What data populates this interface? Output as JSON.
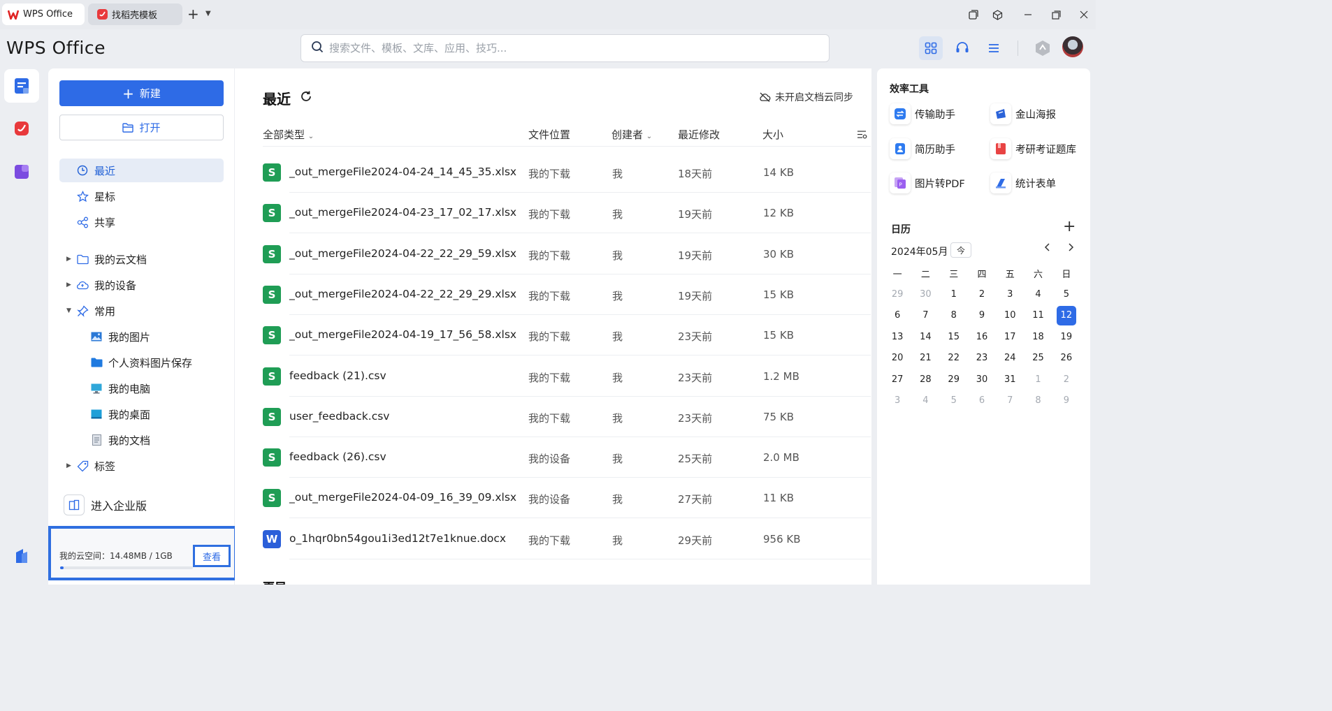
{
  "tabs": [
    {
      "label": "WPS Office"
    },
    {
      "label": "找稻壳模板"
    }
  ],
  "header": {
    "logo": "WPS Office",
    "search_placeholder": "搜索文件、模板、文库、应用、技巧..."
  },
  "sidebar": {
    "new_label": "新建",
    "open_label": "打开",
    "nav": [
      {
        "label": "最近"
      },
      {
        "label": "星标"
      },
      {
        "label": "共享"
      },
      {
        "label": "我的云文档"
      },
      {
        "label": "我的设备"
      },
      {
        "label": "常用"
      },
      {
        "label": "我的图片"
      },
      {
        "label": "个人资料图片保存"
      },
      {
        "label": "我的电脑"
      },
      {
        "label": "我的桌面"
      },
      {
        "label": "我的文档"
      },
      {
        "label": "标签"
      }
    ],
    "enterprise_label": "进入企业版",
    "cloud_space_text": "我的云空间：14.48MB / 1GB",
    "cloud_view_label": "查看",
    "cloud_usage_fraction": 0.014
  },
  "main": {
    "title": "最近",
    "sync_status": "未开启文档云同步",
    "columns": {
      "type": "全部类型",
      "location": "文件位置",
      "creator": "创建者",
      "modified": "最近修改",
      "size": "大小"
    },
    "files": [
      {
        "icon": "S",
        "color": "#1f9d55",
        "name": "_out_mergeFile2024-04-24_14_45_35.xlsx",
        "location": "我的下载",
        "creator": "我",
        "modified": "18天前",
        "size": "14 KB"
      },
      {
        "icon": "S",
        "color": "#1f9d55",
        "name": "_out_mergeFile2024-04-23_17_02_17.xlsx",
        "location": "我的下载",
        "creator": "我",
        "modified": "19天前",
        "size": "12 KB"
      },
      {
        "icon": "S",
        "color": "#1f9d55",
        "name": "_out_mergeFile2024-04-22_22_29_59.xlsx",
        "location": "我的下载",
        "creator": "我",
        "modified": "19天前",
        "size": "30 KB"
      },
      {
        "icon": "S",
        "color": "#1f9d55",
        "name": "_out_mergeFile2024-04-22_22_29_29.xlsx",
        "location": "我的下载",
        "creator": "我",
        "modified": "19天前",
        "size": "15 KB"
      },
      {
        "icon": "S",
        "color": "#1f9d55",
        "name": "_out_mergeFile2024-04-19_17_56_58.xlsx",
        "location": "我的下载",
        "creator": "我",
        "modified": "23天前",
        "size": "15 KB"
      },
      {
        "icon": "S",
        "color": "#1f9d55",
        "name": "feedback (21).csv",
        "location": "我的下载",
        "creator": "我",
        "modified": "23天前",
        "size": "1.2 MB"
      },
      {
        "icon": "S",
        "color": "#1f9d55",
        "name": "user_feedback.csv",
        "location": "我的下载",
        "creator": "我",
        "modified": "23天前",
        "size": "75 KB"
      },
      {
        "icon": "S",
        "color": "#1f9d55",
        "name": "feedback (26).csv",
        "location": "我的设备",
        "creator": "我",
        "modified": "25天前",
        "size": "2.0 MB"
      },
      {
        "icon": "S",
        "color": "#1f9d55",
        "name": "_out_mergeFile2024-04-09_16_39_09.xlsx",
        "location": "我的设备",
        "creator": "我",
        "modified": "27天前",
        "size": "11 KB"
      },
      {
        "icon": "W",
        "color": "#2b5fd9",
        "name": "o_1hqr0bn54gou1i3ed12t7e1knue.docx",
        "location": "我的下载",
        "creator": "我",
        "modified": "29天前",
        "size": "956 KB"
      }
    ],
    "next_section": "更早"
  },
  "tools": {
    "title": "效率工具",
    "items": [
      {
        "label": "传输助手"
      },
      {
        "label": "金山海报"
      },
      {
        "label": "简历助手"
      },
      {
        "label": "考研考证题库"
      },
      {
        "label": "图片转PDF"
      },
      {
        "label": "统计表单"
      }
    ]
  },
  "calendar": {
    "title": "日历",
    "month": "2024年05月",
    "today_label": "今",
    "weekdays": [
      "一",
      "二",
      "三",
      "四",
      "五",
      "六",
      "日"
    ],
    "weeks": [
      [
        "29",
        "30",
        "1",
        "2",
        "3",
        "4",
        "5"
      ],
      [
        "6",
        "7",
        "8",
        "9",
        "10",
        "11",
        "12"
      ],
      [
        "13",
        "14",
        "15",
        "16",
        "17",
        "18",
        "19"
      ],
      [
        "20",
        "21",
        "22",
        "23",
        "24",
        "25",
        "26"
      ],
      [
        "27",
        "28",
        "29",
        "30",
        "31",
        "1",
        "2"
      ],
      [
        "3",
        "4",
        "5",
        "6",
        "7",
        "8",
        "9"
      ]
    ],
    "today": "12"
  },
  "colors": {
    "accent": "#2e6be6",
    "highlight_border": "#2f6fe0"
  }
}
